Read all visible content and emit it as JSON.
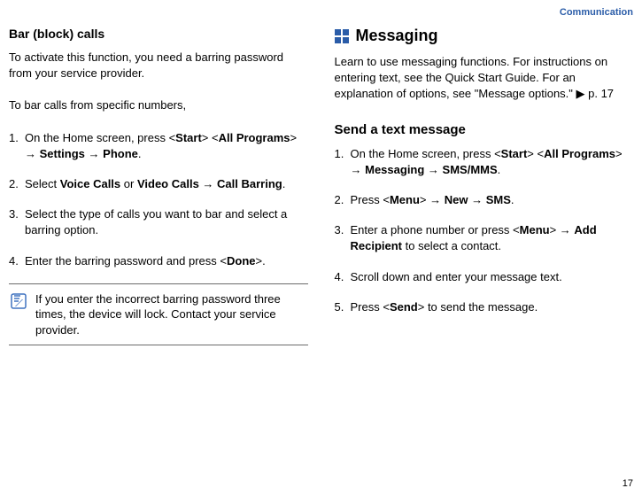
{
  "header": {
    "section": "Communication"
  },
  "pageNumber": "17",
  "left": {
    "title": "Bar (block) calls",
    "intro": "To activate this function, you need a barring password from your service provider.",
    "lead": "To bar calls from specific numbers,",
    "steps": {
      "s1a": "On the Home screen, press <",
      "s1b": "Start",
      "s1c": "> <",
      "s1d": "All Programs",
      "s1e": "> → ",
      "s1f": "Settings",
      "s1g": " → ",
      "s1h": "Phone",
      "s1i": ".",
      "s2a": "Select ",
      "s2b": "Voice Calls",
      "s2c": " or ",
      "s2d": "Video Calls",
      "s2e": " → ",
      "s2f": "Call Barring",
      "s2g": ".",
      "s3": "Select the type of calls you want to bar and select a barring option.",
      "s4a": "Enter the barring password and press <",
      "s4b": "Done",
      "s4c": ">."
    },
    "note": "If you enter the incorrect barring password three times, the device will lock. Contact your service provider."
  },
  "right": {
    "title": "Messaging",
    "intro_a": "Learn to use messaging functions. For instructions on entering text, see the Quick Start Guide. For an explanation of options, see \"Message options.\" ",
    "intro_arrow": "▶",
    "intro_b": " p. 17",
    "sub": "Send a text message",
    "steps": {
      "s1a": "On the Home screen, press <",
      "s1b": "Start",
      "s1c": "> <",
      "s1d": "All Programs",
      "s1e": "> → ",
      "s1f": "Messaging",
      "s1g": " → ",
      "s1h": "SMS/MMS",
      "s1i": ".",
      "s2a": "Press <",
      "s2b": "Menu",
      "s2c": "> → ",
      "s2d": "New",
      "s2e": " → ",
      "s2f": "SMS",
      "s2g": ".",
      "s3a": "Enter a phone number or press <",
      "s3b": "Menu",
      "s3c": "> → ",
      "s3d": "Add Recipient",
      "s3e": " to select a contact.",
      "s4": "Scroll down and enter your message text.",
      "s5a": "Press <",
      "s5b": "Send",
      "s5c": "> to send the message."
    }
  }
}
